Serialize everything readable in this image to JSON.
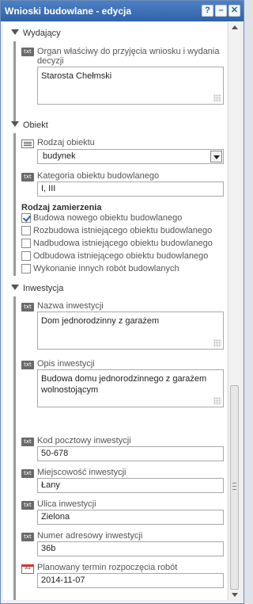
{
  "window": {
    "title": "Wnioski budowlane - edycja",
    "buttons": {
      "help": "?",
      "minimize": "–",
      "close": "✕"
    }
  },
  "sections": {
    "wydajacy": {
      "title": "Wydający",
      "organ_label": "Organ właściwy do przyjęcia wniosku i wydania decyzji",
      "organ_value": "Starosta Chełmski"
    },
    "obiekt": {
      "title": "Obiekt",
      "rodzaj_label": "Rodzaj obiektu",
      "rodzaj_value": "budynek",
      "kategoria_label": "Kategoria obiektu budowlanego",
      "kategoria_value": "I, III",
      "zamierzenie_title": "Rodzaj zamierzenia",
      "zamierzenie_options": [
        {
          "label": "Budowa nowego obiektu budowlanego",
          "checked": true
        },
        {
          "label": "Rozbudowa istniejącego obiektu budowlanego",
          "checked": false
        },
        {
          "label": "Nadbudowa istniejącego obiektu budowlanego",
          "checked": false
        },
        {
          "label": "Odbudowa istniejącego obiektu budowlanego",
          "checked": false
        },
        {
          "label": "Wykonanie innych robót budowlanych",
          "checked": false
        }
      ]
    },
    "inwestycja": {
      "title": "Inwestycja",
      "nazwa_label": "Nazwa inwestycji",
      "nazwa_value": "Dom jednorodzinny z garażem",
      "opis_label": "Opis inwestycji",
      "opis_value": "Budowa domu jednorodzinnego z garażem wolnostojącym",
      "kod_label": "Kod pocztowy inwestycji",
      "kod_value": "50-678",
      "miejscowosc_label": "Miejscowość inwestycji",
      "miejscowosc_value": "Łany",
      "ulica_label": "Ulica inwestycji",
      "ulica_value": "Zielona",
      "numer_label": "Numer adresowy inwestycji",
      "numer_value": "36b",
      "termin_label": "Planowany termin rozpoczęcia robót",
      "termin_value": "2014-11-07"
    }
  },
  "icons": {
    "text_field": "txt",
    "calendar": "31"
  },
  "colors": {
    "titlebar": "#3a6db5",
    "check": "#2d5fa8"
  }
}
